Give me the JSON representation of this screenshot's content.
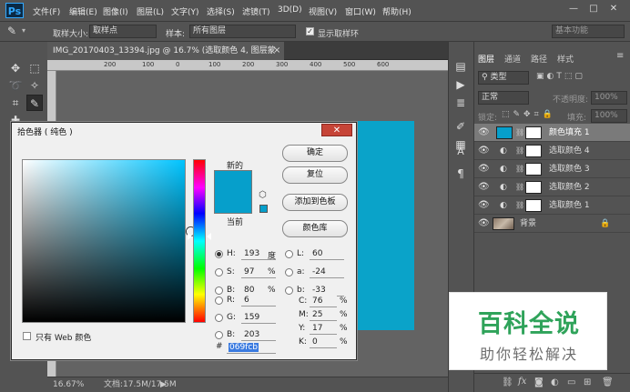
{
  "app": {
    "logo": "Ps"
  },
  "menu": {
    "items": [
      "文件(F)",
      "编辑(E)",
      "图像(I)",
      "图层(L)",
      "文字(Y)",
      "选择(S)",
      "滤镜(T)",
      "3D(D)",
      "视图(V)",
      "窗口(W)",
      "帮助(H)"
    ]
  },
  "window_buttons": {
    "minimize": "—",
    "restore": "□",
    "close": "✕"
  },
  "options_bar": {
    "sample_size_label": "取样大小:",
    "sample_size_value": "取样点",
    "sample_label": "样本:",
    "sample_value": "所有图层",
    "show_ring_label": "显示取样环",
    "workspace": "基本功能"
  },
  "document": {
    "tab_title": "IMG_20170403_13394.jpg @ 16.7% (选取颜色 4, 图层蒙版/8) *",
    "tab_close": "×",
    "ruler_ticks": [
      "200",
      "100",
      "0",
      "100",
      "200",
      "300",
      "400",
      "500",
      "600"
    ],
    "zoom": "16.67%",
    "doc_info": "文档:17.5M/17.5M"
  },
  "color_picker": {
    "title": "拾色器 ( 纯色 )",
    "close": "✕",
    "new_label": "新的",
    "current_label": "当前",
    "buttons": {
      "ok": "确定",
      "reset": "复位",
      "add_swatch": "添加到色板",
      "libraries": "颜色库"
    },
    "fields": {
      "H": {
        "label": "H:",
        "value": "193",
        "unit": "度"
      },
      "S": {
        "label": "S:",
        "value": "97",
        "unit": "%"
      },
      "Bv": {
        "label": "B:",
        "value": "80",
        "unit": "%"
      },
      "R": {
        "label": "R:",
        "value": "6"
      },
      "G": {
        "label": "G:",
        "value": "159"
      },
      "Bl": {
        "label": "B:",
        "value": "203"
      },
      "L": {
        "label": "L:",
        "value": "60"
      },
      "a": {
        "label": "a:",
        "value": "-24"
      },
      "b": {
        "label": "b:",
        "value": "-33"
      },
      "C": {
        "label": "C:",
        "value": "76",
        "unit": "%"
      },
      "M": {
        "label": "M:",
        "value": "25",
        "unit": "%"
      },
      "Y": {
        "label": "Y:",
        "value": "17",
        "unit": "%"
      },
      "K": {
        "label": "K:",
        "value": "0",
        "unit": "%"
      }
    },
    "hex_label": "#",
    "hex_value": "069fcb",
    "web_only_label": "只有 Web 颜色",
    "new_color": "#069fcb",
    "current_color": "#069fcb"
  },
  "panels": {
    "tabs": [
      "图层",
      "通道",
      "路径",
      "样式"
    ],
    "filter_kind": "类型",
    "blend_mode": "正常",
    "opacity_label": "不透明度:",
    "opacity_value": "100%",
    "lock_label": "锁定:",
    "fill_label": "填充:",
    "fill_value": "100%",
    "layers": [
      {
        "name": "颜色填充 1",
        "selected": true
      },
      {
        "name": "选取颜色 4",
        "selected": false
      },
      {
        "name": "选取颜色 3",
        "selected": false
      },
      {
        "name": "选取颜色 2",
        "selected": false
      },
      {
        "name": "选取颜色 1",
        "selected": false
      },
      {
        "name": "背景",
        "selected": false
      }
    ]
  },
  "watermark": {
    "main": "百科全说",
    "sub": "助你轻松解决"
  },
  "colors": {
    "accent_fill": "#0aa3c9",
    "watermark_green": "#2fa35a"
  }
}
